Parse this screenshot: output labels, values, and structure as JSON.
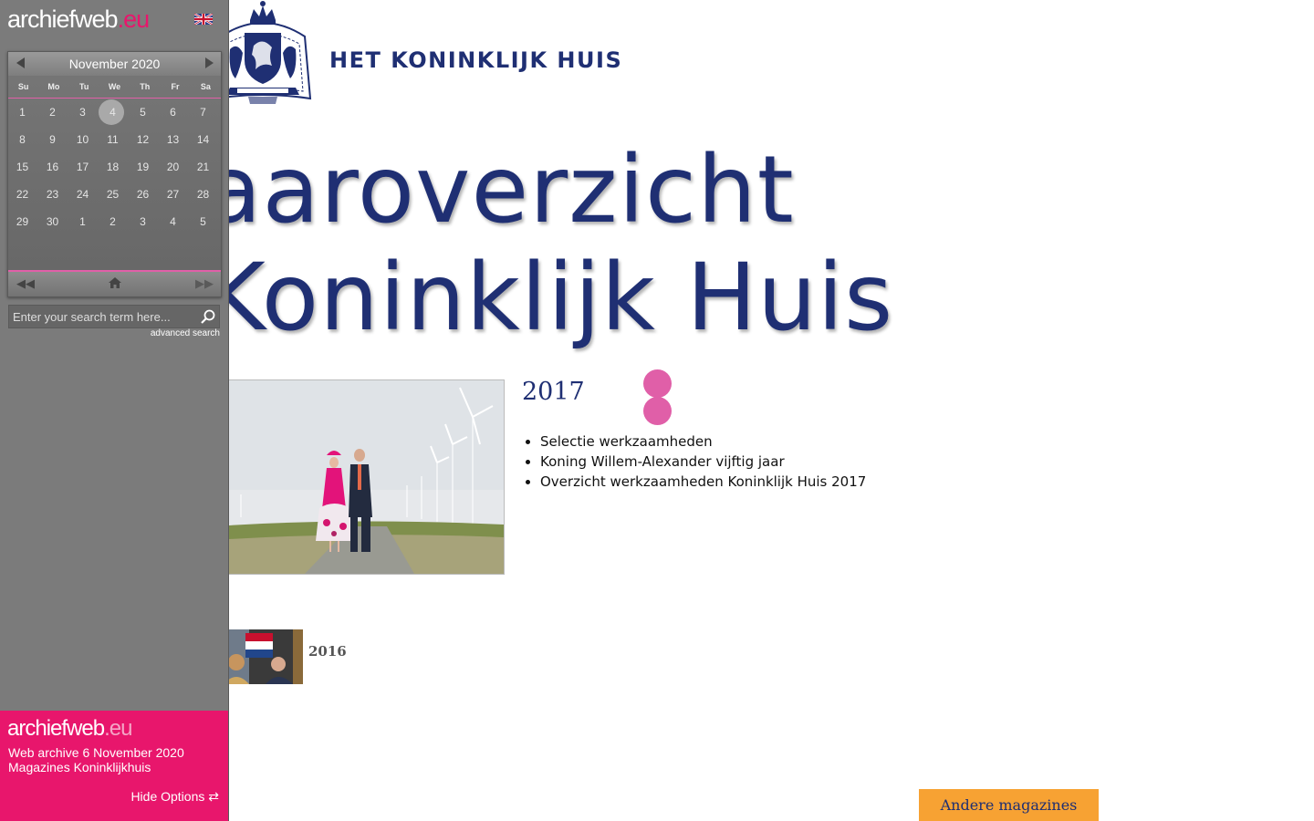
{
  "archive": {
    "logo_main": "archiefweb",
    "logo_tld": ".eu",
    "language_icon": "uk-flag-icon",
    "calendar": {
      "month_label": "November 2020",
      "weekdays": [
        "Su",
        "Mo",
        "Tu",
        "We",
        "Th",
        "Fr",
        "Sa"
      ],
      "days": [
        "1",
        "2",
        "3",
        "4",
        "5",
        "6",
        "7",
        "8",
        "9",
        "10",
        "11",
        "12",
        "13",
        "14",
        "15",
        "16",
        "17",
        "18",
        "19",
        "20",
        "21",
        "22",
        "23",
        "24",
        "25",
        "26",
        "27",
        "28",
        "29",
        "30",
        "1",
        "2",
        "3",
        "4",
        "5"
      ],
      "selected_day": "4",
      "nav_icons": [
        "rewind-icon",
        "home-icon",
        "fast-forward-icon"
      ]
    },
    "search": {
      "placeholder": "Enter your search term here...",
      "icon": "search-icon"
    },
    "advanced_search_label": "advanced search",
    "footer": {
      "logo_main": "archiefweb",
      "logo_tld": ".eu",
      "line1": "Web archive 6 November 2020",
      "line2": "Magazines Koninklijkhuis",
      "hide_options_label": "Hide Options ⇄"
    },
    "accent_color": "#e8166c"
  },
  "page": {
    "site_title": "HET KONINKLIJK HUIS",
    "hero_line1": "aaroverzicht",
    "hero_line2": "Koninklijk Huis",
    "featured_year": "2017",
    "featured_items": [
      "Selectie werkzaamheden",
      "Koning Willem-Alexander vijftig jaar",
      "Overzicht werkzaamheden Koninklijk Huis 2017"
    ],
    "other_year": "2016",
    "andere_button": "Andere magazines",
    "brand_color": "#1f2f73",
    "button_color": "#f7a233",
    "dot_color": "#e05fa8"
  }
}
